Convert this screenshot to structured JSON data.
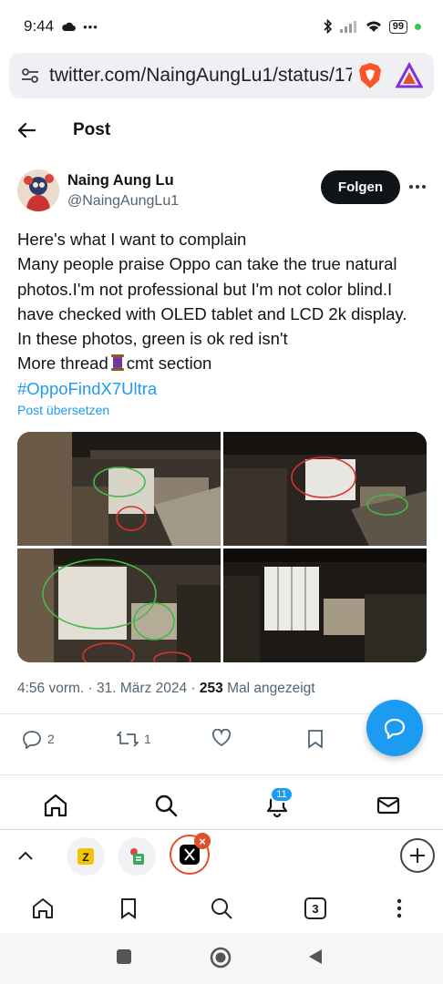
{
  "status_bar": {
    "time": "9:44",
    "extra": "•••",
    "battery": "99"
  },
  "browser": {
    "url": "twitter.com/NaingAungLu1/status/177",
    "tab_count": "3"
  },
  "header": {
    "title": "Post"
  },
  "author": {
    "name": "Naing Aung Lu",
    "handle": "@NaingAungLu1"
  },
  "follow_label": "Folgen",
  "tweet": {
    "line1": "Here's what I want to complain",
    "line2": "Many people praise Oppo can take the true natural",
    "line3": "photos.I'm not professional but I'm not color blind.I",
    "line4": "have checked with OLED tablet and LCD 2k display.",
    "line5": "In these photos, green is ok red isn't",
    "line6_a": "More thread",
    "line6_b": "cmt section",
    "hashtag": "#OppoFindX7Ultra",
    "translate": "Post übersetzen"
  },
  "meta": {
    "time": "4:56 vorm.",
    "sep1": " · ",
    "date": "31. März 2024",
    "sep2": " · ",
    "views": "253",
    "views_label": " Mal angezeigt"
  },
  "actions": {
    "replies": "2",
    "reposts": "1"
  },
  "x_nav": {
    "notifications_badge": "11"
  },
  "colors": {
    "accent": "#1d9bf0",
    "tab_active_ring": "#e0502a",
    "text": "#0f1419",
    "muted": "#536471"
  }
}
